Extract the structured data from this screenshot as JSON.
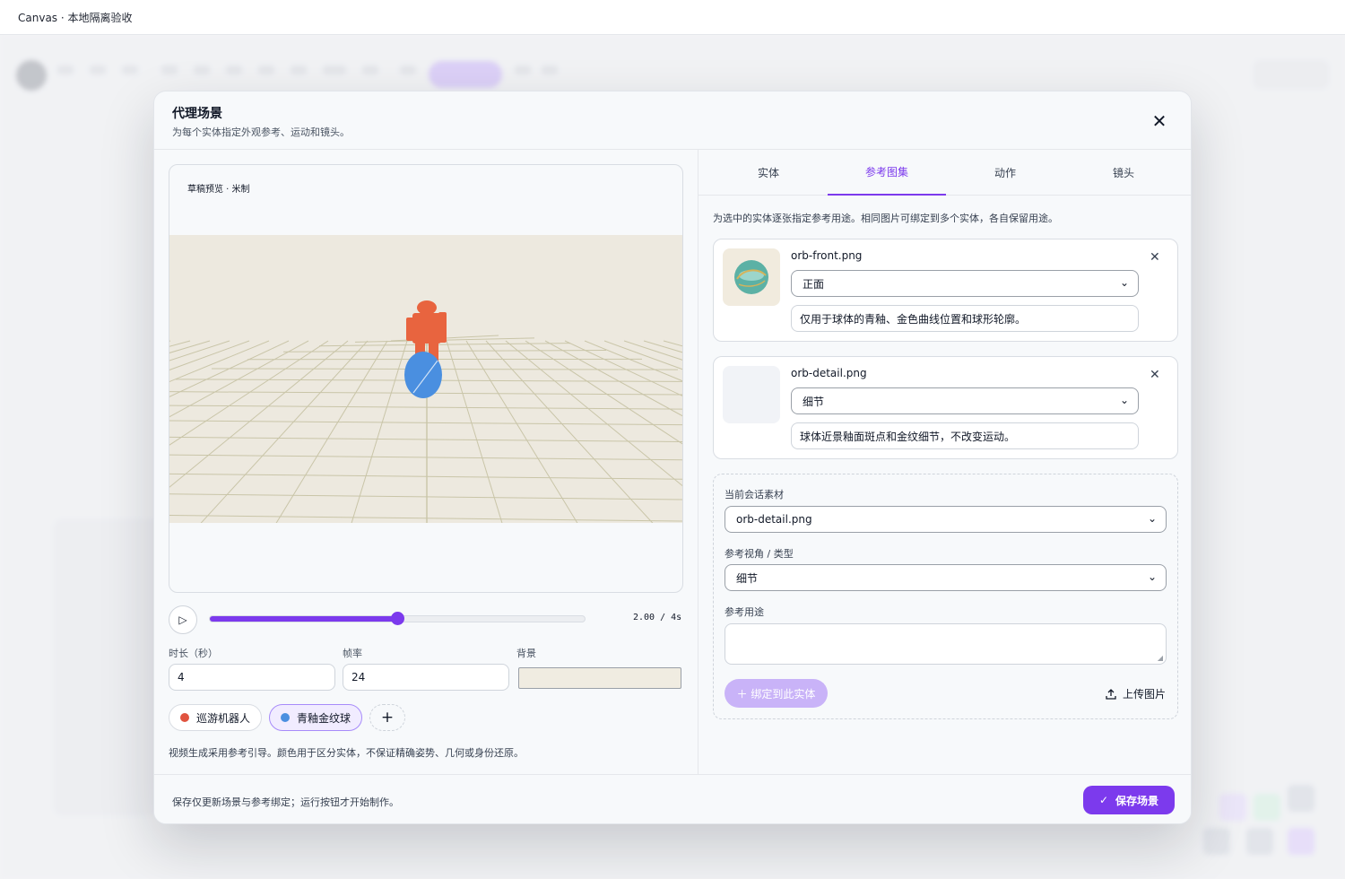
{
  "window": {
    "title": "Canvas · 本地隔离验收"
  },
  "modal": {
    "title": "代理场景",
    "subtitle": "为每个实体指定外观参考、运动和镜头。",
    "close_icon": "close-icon"
  },
  "preview": {
    "label": "草稿预览 · 米制",
    "stage_color": "#ede9df",
    "grid_color": "#c9c5a8",
    "robot_color": "#e8643f",
    "orb_color": "#4a8fe0"
  },
  "playback": {
    "time_readout": "2.00 / 4s",
    "current_seconds": 2.0,
    "total_seconds": 4,
    "progress_fraction": 0.5,
    "accent": "#7c3aed"
  },
  "settings": {
    "duration_label": "时长（秒）",
    "duration_value": "4",
    "fps_label": "帧率",
    "fps_value": "24",
    "background_label": "背景",
    "background_color": "#f0ece1"
  },
  "entities": [
    {
      "label": "巡游机器人",
      "color": "#e0533f",
      "active": false
    },
    {
      "label": "青釉金纹球",
      "color": "#4a8fe0",
      "active": true
    }
  ],
  "entity_add_label": "+",
  "left_note": "视频生成采用参考引导。颜色用于区分实体，不保证精确姿势、几何或身份还原。",
  "tabs": [
    {
      "label": "实体",
      "active": false
    },
    {
      "label": "参考图集",
      "active": true
    },
    {
      "label": "动作",
      "active": false
    },
    {
      "label": "镜头",
      "active": false
    }
  ],
  "reference_note": "为选中的实体逐张指定参考用途。相同图片可绑定到多个实体，各自保留用途。",
  "references": [
    {
      "file": "orb-front.png",
      "view": "正面",
      "purpose": "仅用于球体的青釉、金色曲线位置和球形轮廓。",
      "thumb_bg": "#f1ebde"
    },
    {
      "file": "orb-detail.png",
      "view": "细节",
      "purpose": "球体近景釉面斑点和金纹细节，不改变运动。",
      "thumb_bg": "#f1f3f7"
    }
  ],
  "binding": {
    "asset_label": "当前会话素材",
    "asset_value": "orb-detail.png",
    "view_label": "参考视角 / 类型",
    "view_value": "细节",
    "purpose_label": "参考用途",
    "purpose_value": "",
    "bind_button": "＋ 绑定到此实体",
    "upload_button": "上传图片"
  },
  "footer": {
    "note": "保存仅更新场景与参考绑定；运行按钮才开始制作。",
    "save_button": "保存场景"
  }
}
